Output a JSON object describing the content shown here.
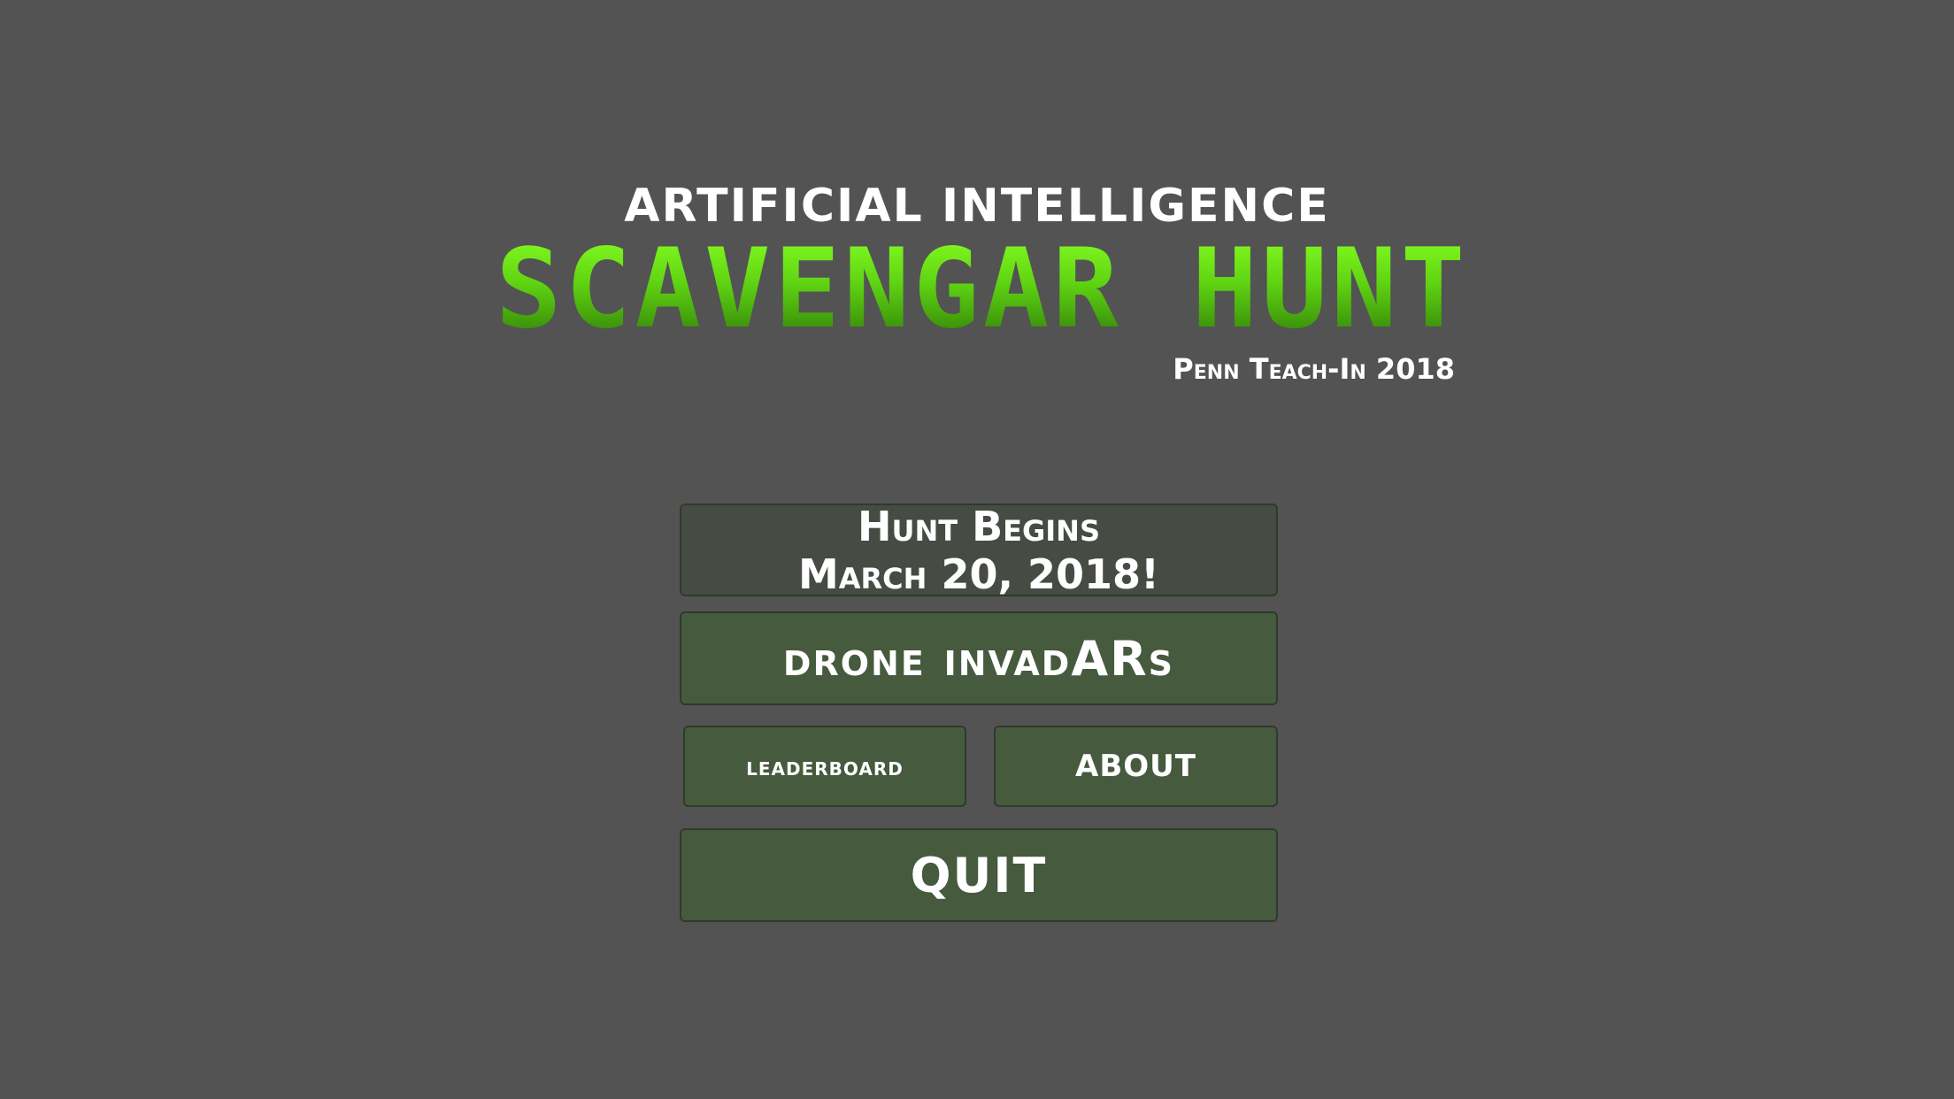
{
  "title": {
    "subtitle": "ARTIFICIAL INTELLIGENCE",
    "game_name": "SCAVENGAR HUNT",
    "tagline": "Penn Teach-In 2018"
  },
  "announcement": {
    "line1": "Hunt Begins",
    "line2": "March 20, 2018!"
  },
  "menu": {
    "drone_invaders_label": "drone invadARs",
    "leaderboard_label": "leaderboard",
    "about_label": "ABOUT",
    "quit_label": "QUIT"
  },
  "colors": {
    "background": "#535353",
    "button": "#465a3e",
    "title_green": "#5fc411"
  }
}
